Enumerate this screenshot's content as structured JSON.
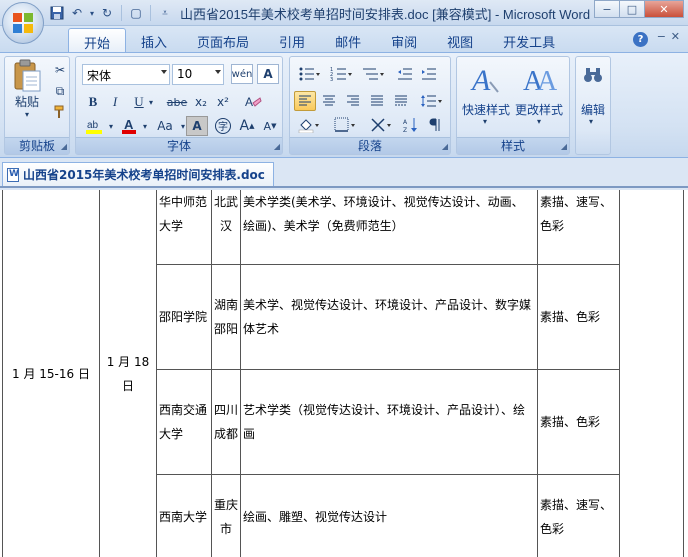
{
  "window": {
    "title": "山西省2015年美术校考单招时间安排表.doc [兼容模式] - Microsoft Word"
  },
  "quick_access": {
    "save_icon": "save-icon",
    "undo_icon": "undo-icon",
    "redo_icon": "redo-icon"
  },
  "ribbon": {
    "tabs": [
      "开始",
      "插入",
      "页面布局",
      "引用",
      "邮件",
      "审阅",
      "视图",
      "开发工具"
    ],
    "active_tab": "开始",
    "groups": {
      "clipboard": {
        "label": "剪贴板",
        "paste_label": "粘贴"
      },
      "font": {
        "label": "字体",
        "font_name": "宋体",
        "font_size": "10",
        "bold": "B",
        "italic": "I",
        "underline": "U",
        "strike": "abe",
        "subscript": "x₂",
        "superscript": "x²",
        "change_case": "Aa",
        "grow": "A",
        "shrink": "A"
      },
      "paragraph": {
        "label": "段落"
      },
      "styles": {
        "label": "样式",
        "quick_styles": "快速样式",
        "change_styles": "更改样式"
      },
      "editing": {
        "label": "编辑"
      }
    }
  },
  "document_tab": {
    "label": "山西省2015年美术校考单招时间安排表.doc"
  },
  "table": {
    "date_range": "1 月 15-16 日",
    "exam_date": "1 月 18 日",
    "rows": [
      {
        "school": "华中师范大学",
        "city": "北武汉",
        "majors": "美术学类(美术学、环境设计、视觉传达设计、动画、绘画)、美术学（免费师范生）",
        "subjects": "素描、速写、色彩"
      },
      {
        "school": "邵阳学院",
        "city": "湖南邵阳",
        "majors": "美术学、视觉传达设计、环境设计、产品设计、数字媒体艺术",
        "subjects": "素描、色彩"
      },
      {
        "school": "西南交通大学",
        "city": "四川成都",
        "majors": "艺术学类（视觉传达设计、环境设计、产品设计）、绘画",
        "subjects": "素描、色彩"
      },
      {
        "school": "西南大学",
        "city": "重庆市",
        "majors": "绘画、雕塑、视觉传达设计",
        "subjects": "素描、速写、色彩"
      }
    ]
  }
}
